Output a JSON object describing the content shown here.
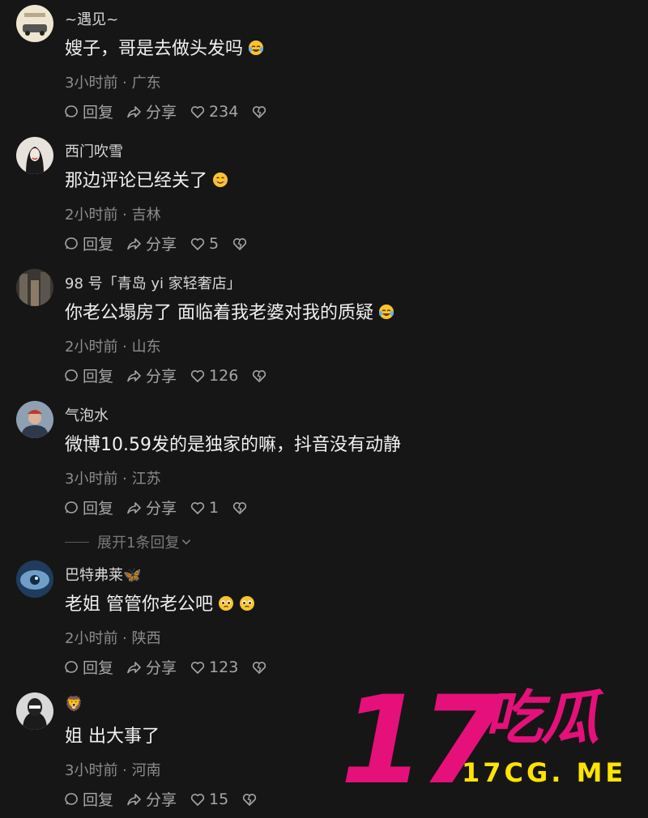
{
  "actions": {
    "reply": "回复",
    "share": "分享"
  },
  "comments": [
    {
      "username": "~遇见~",
      "text": "嫂子，哥是去做头发吗",
      "emoji": "laugh-cry-emoji",
      "time": "3小时前",
      "location": "广东",
      "likes": "234"
    },
    {
      "username": "西门吹雪",
      "text": "那边评论已经关了",
      "emoji": "smile-emoji",
      "time": "2小时前",
      "location": "吉林",
      "likes": "5"
    },
    {
      "username": "98 号「青岛 yi 家轻奢店」",
      "text": "你老公塌房了  面临着我老婆对我的质疑",
      "emoji": "laugh-cry-emoji",
      "time": "2小时前",
      "location": "山东",
      "likes": "126"
    },
    {
      "username": "气泡水",
      "text": "微博10.59发的是独家的嘛，抖音没有动静",
      "time": "3小时前",
      "location": "江苏",
      "likes": "1"
    },
    {
      "username": "巴特弗莱🦋",
      "text": "老姐 管管你老公吧",
      "emoji": "pleading-emoji",
      "time": "2小时前",
      "location": "陕西",
      "likes": "123"
    },
    {
      "username": "🦁",
      "text": "姐 出大事了",
      "time": "3小时前",
      "location": "河南",
      "likes": "15"
    }
  ],
  "expand_replies": "展开1条回复",
  "watermark": {
    "number": "17",
    "name": "吃瓜",
    "url": "17CG. ME"
  },
  "colors": {
    "background": "#161616",
    "watermark_pink": "#e5107a",
    "watermark_yellow": "#ffe400"
  }
}
